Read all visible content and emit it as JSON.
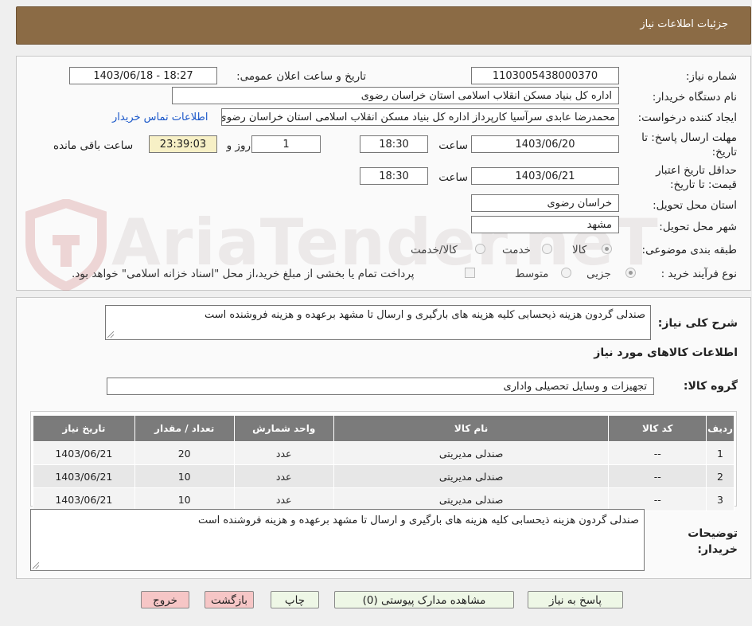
{
  "header": {
    "title": "جزئیات اطلاعات نیاز"
  },
  "watermark": {
    "text": "AriaTender.neT"
  },
  "fields": {
    "need_number_label": "شماره نیاز:",
    "need_number": "1103005438000370",
    "announce_label": "تاریخ و ساعت اعلان عمومی:",
    "announce_value": "1403/06/18 - 18:27",
    "buyer_org_label": "نام دستگاه خریدار:",
    "buyer_org": "اداره کل بنیاد مسکن انقلاب اسلامی استان خراسان رضوی",
    "requester_label": "ایجاد کننده درخواست:",
    "requester": "محمدرضا عابدی سرآسیا کارپرداز اداره کل بنیاد مسکن انقلاب اسلامی استان خراسان رضوی",
    "contact_link": "اطلاعات تماس خریدار",
    "reply_deadline_label": "مهلت ارسال پاسخ: تا تاریخ:",
    "reply_date": "1403/06/20",
    "time_label": "ساعت",
    "reply_time": "18:30",
    "days_value": "1",
    "day_and_label": "روز و",
    "remaining_time": "23:39:03",
    "remaining_label": "ساعت باقی مانده",
    "price_validity_label": "حداقل تاریخ اعتبار قیمت: تا تاریخ:",
    "price_date": "1403/06/21",
    "price_time": "18:30",
    "province_label": "استان محل تحویل:",
    "province": "خراسان رضوی",
    "city_label": "شهر محل تحویل:",
    "city": "مشهد",
    "category_label": "طبقه بندی موضوعی:",
    "category_options": [
      "کالا",
      "خدمت",
      "کالا/خدمت"
    ],
    "process_label": "نوع فرآیند خرید :",
    "process_options": [
      "جزیی",
      "متوسط"
    ],
    "payment_note": "پرداخت تمام یا بخشی از مبلغ خرید،از محل \"اسناد خزانه اسلامی\" خواهد بود."
  },
  "summary": {
    "label": "شرح کلی نیاز:",
    "value": "صندلی گردون هزینه ذیحسابی کلیه هزینه های بارگیری و ارسال تا مشهد برعهده و هزینه فروشنده است"
  },
  "goods": {
    "title": "اطلاعات کالاهای مورد نیاز",
    "group_label": "گروه کالا:",
    "group_value": "تجهیزات و وسایل تحصیلی واداری",
    "columns": [
      "ردیف",
      "کد کالا",
      "نام کالا",
      "واحد شمارش",
      "تعداد / مقدار",
      "تاریخ نیاز"
    ],
    "rows": [
      [
        "1",
        "--",
        "صندلی مدیریتی",
        "عدد",
        "20",
        "1403/06/21"
      ],
      [
        "2",
        "--",
        "صندلی مدیریتی",
        "عدد",
        "10",
        "1403/06/21"
      ],
      [
        "3",
        "--",
        "صندلی مدیریتی",
        "عدد",
        "10",
        "1403/06/21"
      ]
    ]
  },
  "buyer_notes": {
    "label": "توضیحات خریدار:",
    "value": "صندلی گردون هزینه ذیحسابی کلیه هزینه های بارگیری و ارسال تا مشهد برعهده و هزینه فروشنده است"
  },
  "buttons": {
    "reply": "پاسخ به نیاز",
    "attachments": "مشاهده مدارک پیوستی (0)",
    "print": "چاپ",
    "back": "بازگشت",
    "exit": "خروج"
  }
}
